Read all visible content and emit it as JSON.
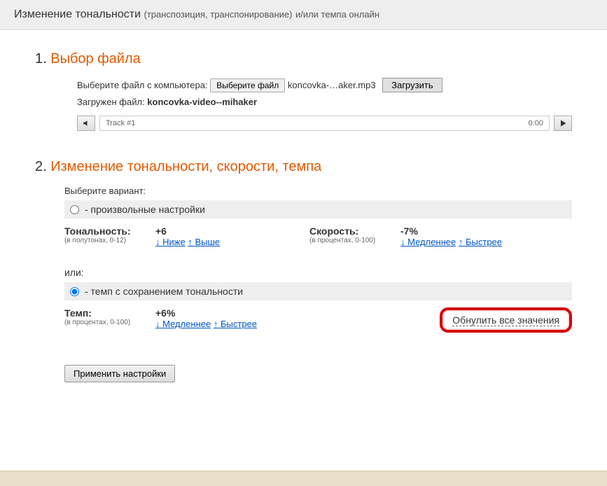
{
  "header": {
    "title": "Изменение тональности",
    "sub": "(транспозиция, транспонирование)",
    "tail": "и/или темпа онлайн"
  },
  "section1": {
    "num": "1.",
    "title": "Выбор файла",
    "choose_label": "Выберите файл с компьютера:",
    "choose_button": "Выберите файл",
    "chosen_file": "koncovka-…aker.mp3",
    "upload_button": "Загрузить",
    "loaded_prefix": "Загружен файл:",
    "loaded_name": "koncovka-video--mihaker",
    "track_label": "Track #1",
    "track_time": "0:00"
  },
  "section2": {
    "num": "2.",
    "title": "Изменение тональности, скорости, темпа",
    "choose_variant": "Выберите вариант:",
    "radio_custom": "- произвольные настройки",
    "tone_label": "Тональность:",
    "tone_hint": "(в полутонах, 0-12)",
    "tone_value": "+6",
    "tone_lower": "↓ Ниже",
    "tone_higher": "↑ Выше",
    "speed_label": "Скорость:",
    "speed_hint": "(в процентах, 0-100)",
    "speed_value": "-7%",
    "speed_slower": "↓ Медленнее",
    "speed_faster": "↑ Быстрее",
    "or_label": "или:",
    "radio_tempo": "- темп с сохранением тональности",
    "tempo_label": "Темп:",
    "tempo_hint": "(в процентах, 0-100)",
    "tempo_value": "+6%",
    "tempo_slower": "↓ Медленнее",
    "tempo_faster": "↑ Быстрее",
    "reset_label": "Обнулить все значения",
    "apply_button": "Применить настройки"
  }
}
